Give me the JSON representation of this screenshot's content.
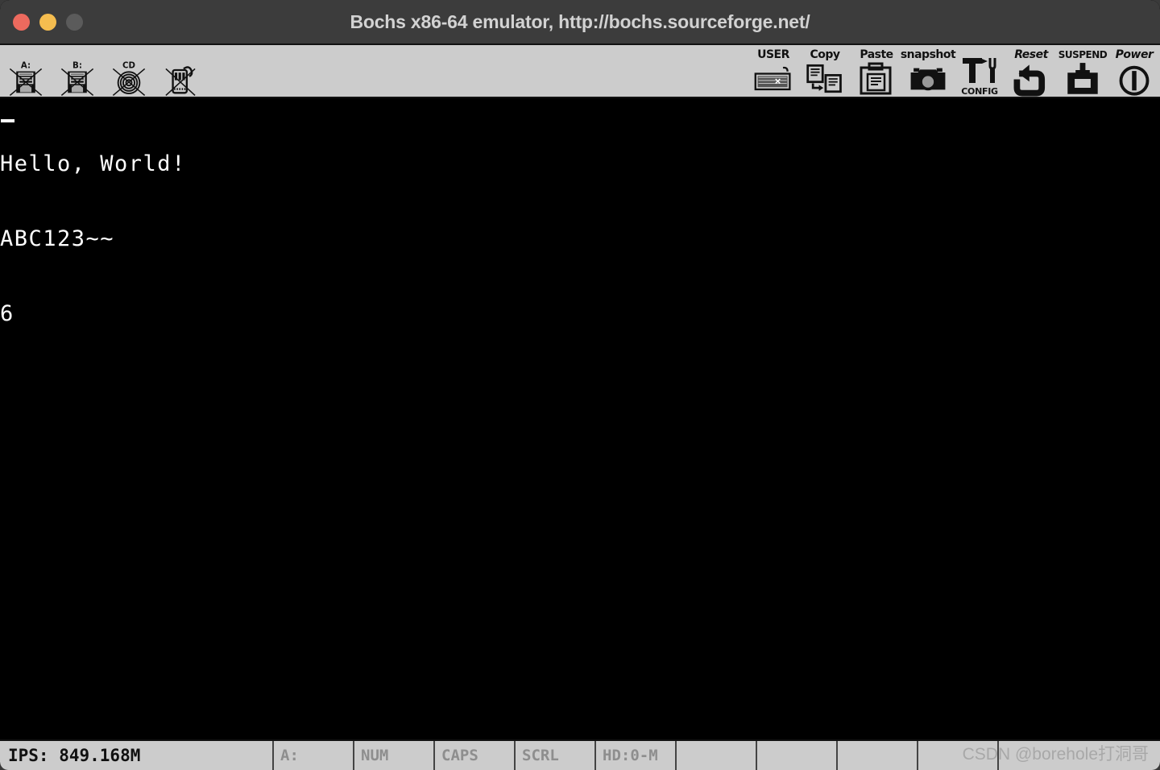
{
  "window": {
    "title": "Bochs x86-64 emulator, http://bochs.sourceforge.net/",
    "controls": {
      "close": "close",
      "minimize": "minimize",
      "zoom": "zoom"
    }
  },
  "toolbar": {
    "left_items": [
      {
        "label": "A:",
        "icon": "floppy-a-icon",
        "state": "disabled"
      },
      {
        "label": "B:",
        "icon": "floppy-b-icon",
        "state": "disabled"
      },
      {
        "label": "CD",
        "icon": "cdrom-icon",
        "state": "disabled"
      },
      {
        "label": "",
        "icon": "usb-icon",
        "state": "disabled"
      }
    ],
    "right_items": [
      {
        "label": "USER",
        "sublabel": "",
        "icon": "keyboard-icon",
        "style": "plain"
      },
      {
        "label": "Copy",
        "sublabel": "",
        "icon": "copy-icon",
        "style": "plain"
      },
      {
        "label": "Paste",
        "sublabel": "",
        "icon": "paste-icon",
        "style": "plain"
      },
      {
        "label": "snapshot",
        "sublabel": "",
        "icon": "camera-icon",
        "style": "plain"
      },
      {
        "label": "",
        "sublabel": "CONFIG",
        "icon": "config-icon",
        "style": "plain"
      },
      {
        "label": "Reset",
        "sublabel": "",
        "icon": "reset-icon",
        "style": "italic"
      },
      {
        "label": "SUSPEND",
        "sublabel": "",
        "icon": "suspend-icon",
        "style": "small"
      },
      {
        "label": "Power",
        "sublabel": "",
        "icon": "power-icon",
        "style": "italic"
      }
    ]
  },
  "screen": {
    "lines": [
      "Hello, World!",
      "ABC123~~",
      "6"
    ],
    "cursor_visible": true
  },
  "statusbar": {
    "ips": "IPS: 849.168M",
    "cells": [
      {
        "label": "A:",
        "active": false
      },
      {
        "label": "NUM",
        "active": false
      },
      {
        "label": "CAPS",
        "active": false
      },
      {
        "label": "SCRL",
        "active": false
      },
      {
        "label": "HD:0-M",
        "active": false
      },
      {
        "label": "",
        "active": false
      },
      {
        "label": "",
        "active": false
      },
      {
        "label": "",
        "active": false
      },
      {
        "label": "",
        "active": false
      },
      {
        "label": "",
        "active": false
      }
    ],
    "watermark": "CSDN @borehole打洞哥"
  },
  "colors": {
    "titlebar": "#3c3c3c",
    "toolbar": "#cccccc",
    "screen": "#000000",
    "close": "#ed6a5e",
    "minimize": "#f5bd4f",
    "zoom": "#5b5b5b",
    "text": "#ffffff"
  }
}
